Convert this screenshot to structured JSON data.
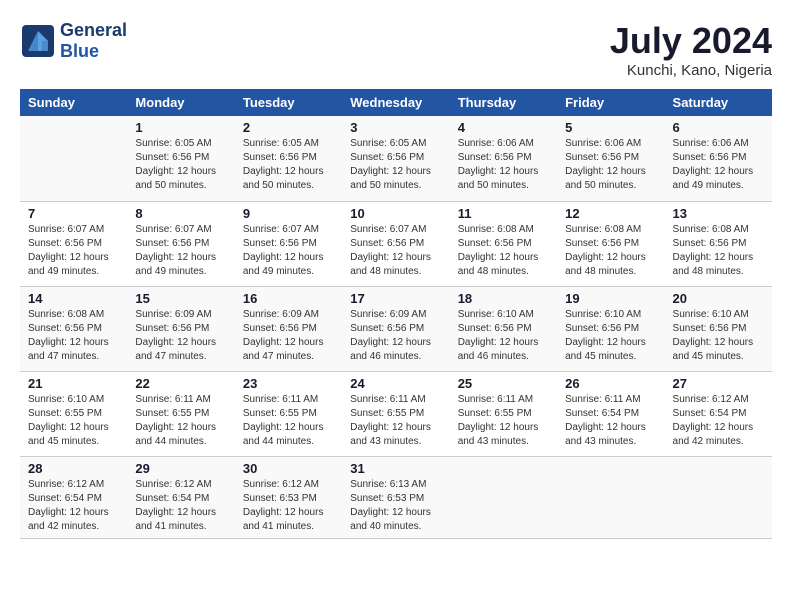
{
  "header": {
    "logo_line1": "General",
    "logo_line2": "Blue",
    "month_year": "July 2024",
    "location": "Kunchi, Kano, Nigeria"
  },
  "days_of_week": [
    "Sunday",
    "Monday",
    "Tuesday",
    "Wednesday",
    "Thursday",
    "Friday",
    "Saturday"
  ],
  "weeks": [
    [
      {
        "day": "",
        "info": ""
      },
      {
        "day": "1",
        "info": "Sunrise: 6:05 AM\nSunset: 6:56 PM\nDaylight: 12 hours\nand 50 minutes."
      },
      {
        "day": "2",
        "info": "Sunrise: 6:05 AM\nSunset: 6:56 PM\nDaylight: 12 hours\nand 50 minutes."
      },
      {
        "day": "3",
        "info": "Sunrise: 6:05 AM\nSunset: 6:56 PM\nDaylight: 12 hours\nand 50 minutes."
      },
      {
        "day": "4",
        "info": "Sunrise: 6:06 AM\nSunset: 6:56 PM\nDaylight: 12 hours\nand 50 minutes."
      },
      {
        "day": "5",
        "info": "Sunrise: 6:06 AM\nSunset: 6:56 PM\nDaylight: 12 hours\nand 50 minutes."
      },
      {
        "day": "6",
        "info": "Sunrise: 6:06 AM\nSunset: 6:56 PM\nDaylight: 12 hours\nand 49 minutes."
      }
    ],
    [
      {
        "day": "7",
        "info": "Sunrise: 6:07 AM\nSunset: 6:56 PM\nDaylight: 12 hours\nand 49 minutes."
      },
      {
        "day": "8",
        "info": "Sunrise: 6:07 AM\nSunset: 6:56 PM\nDaylight: 12 hours\nand 49 minutes."
      },
      {
        "day": "9",
        "info": "Sunrise: 6:07 AM\nSunset: 6:56 PM\nDaylight: 12 hours\nand 49 minutes."
      },
      {
        "day": "10",
        "info": "Sunrise: 6:07 AM\nSunset: 6:56 PM\nDaylight: 12 hours\nand 48 minutes."
      },
      {
        "day": "11",
        "info": "Sunrise: 6:08 AM\nSunset: 6:56 PM\nDaylight: 12 hours\nand 48 minutes."
      },
      {
        "day": "12",
        "info": "Sunrise: 6:08 AM\nSunset: 6:56 PM\nDaylight: 12 hours\nand 48 minutes."
      },
      {
        "day": "13",
        "info": "Sunrise: 6:08 AM\nSunset: 6:56 PM\nDaylight: 12 hours\nand 48 minutes."
      }
    ],
    [
      {
        "day": "14",
        "info": "Sunrise: 6:08 AM\nSunset: 6:56 PM\nDaylight: 12 hours\nand 47 minutes."
      },
      {
        "day": "15",
        "info": "Sunrise: 6:09 AM\nSunset: 6:56 PM\nDaylight: 12 hours\nand 47 minutes."
      },
      {
        "day": "16",
        "info": "Sunrise: 6:09 AM\nSunset: 6:56 PM\nDaylight: 12 hours\nand 47 minutes."
      },
      {
        "day": "17",
        "info": "Sunrise: 6:09 AM\nSunset: 6:56 PM\nDaylight: 12 hours\nand 46 minutes."
      },
      {
        "day": "18",
        "info": "Sunrise: 6:10 AM\nSunset: 6:56 PM\nDaylight: 12 hours\nand 46 minutes."
      },
      {
        "day": "19",
        "info": "Sunrise: 6:10 AM\nSunset: 6:56 PM\nDaylight: 12 hours\nand 45 minutes."
      },
      {
        "day": "20",
        "info": "Sunrise: 6:10 AM\nSunset: 6:56 PM\nDaylight: 12 hours\nand 45 minutes."
      }
    ],
    [
      {
        "day": "21",
        "info": "Sunrise: 6:10 AM\nSunset: 6:55 PM\nDaylight: 12 hours\nand 45 minutes."
      },
      {
        "day": "22",
        "info": "Sunrise: 6:11 AM\nSunset: 6:55 PM\nDaylight: 12 hours\nand 44 minutes."
      },
      {
        "day": "23",
        "info": "Sunrise: 6:11 AM\nSunset: 6:55 PM\nDaylight: 12 hours\nand 44 minutes."
      },
      {
        "day": "24",
        "info": "Sunrise: 6:11 AM\nSunset: 6:55 PM\nDaylight: 12 hours\nand 43 minutes."
      },
      {
        "day": "25",
        "info": "Sunrise: 6:11 AM\nSunset: 6:55 PM\nDaylight: 12 hours\nand 43 minutes."
      },
      {
        "day": "26",
        "info": "Sunrise: 6:11 AM\nSunset: 6:54 PM\nDaylight: 12 hours\nand 43 minutes."
      },
      {
        "day": "27",
        "info": "Sunrise: 6:12 AM\nSunset: 6:54 PM\nDaylight: 12 hours\nand 42 minutes."
      }
    ],
    [
      {
        "day": "28",
        "info": "Sunrise: 6:12 AM\nSunset: 6:54 PM\nDaylight: 12 hours\nand 42 minutes."
      },
      {
        "day": "29",
        "info": "Sunrise: 6:12 AM\nSunset: 6:54 PM\nDaylight: 12 hours\nand 41 minutes."
      },
      {
        "day": "30",
        "info": "Sunrise: 6:12 AM\nSunset: 6:53 PM\nDaylight: 12 hours\nand 41 minutes."
      },
      {
        "day": "31",
        "info": "Sunrise: 6:13 AM\nSunset: 6:53 PM\nDaylight: 12 hours\nand 40 minutes."
      },
      {
        "day": "",
        "info": ""
      },
      {
        "day": "",
        "info": ""
      },
      {
        "day": "",
        "info": ""
      }
    ]
  ]
}
